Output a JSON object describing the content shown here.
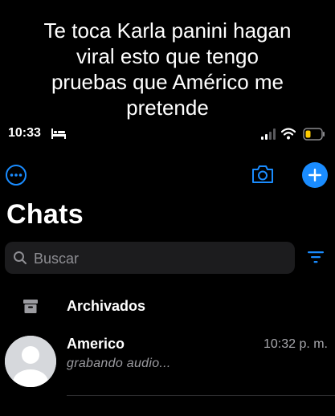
{
  "caption": {
    "lines": [
      "Te toca Karla panini hagan",
      "viral esto que tengo",
      "pruebas que Américo me",
      "pretende"
    ]
  },
  "status_bar": {
    "time": "10:33",
    "icons": [
      "bed-icon",
      "signal-icon",
      "wifi-icon",
      "battery-icon"
    ]
  },
  "header": {
    "title": "Chats",
    "icons": [
      "more-icon",
      "camera-icon",
      "plus-icon"
    ],
    "accent_color": "#1a8cff"
  },
  "search": {
    "placeholder": "Buscar"
  },
  "archived": {
    "label": "Archivados"
  },
  "chats": [
    {
      "name": "Americo",
      "time": "10:32 p. m.",
      "last_message": "grabando audio..."
    }
  ]
}
